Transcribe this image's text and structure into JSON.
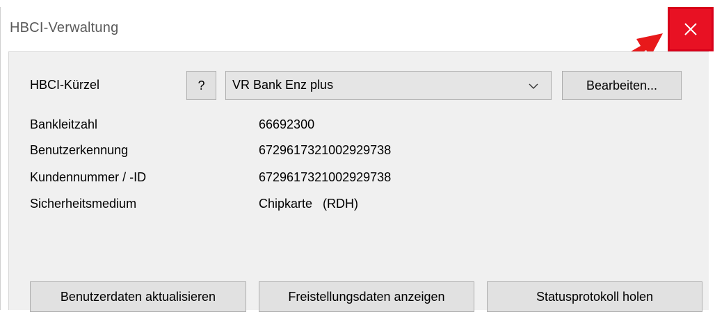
{
  "window": {
    "title": "HBCI-Verwaltung",
    "close_icon": "close-icon",
    "accent_color": "#e81123",
    "annotation_color": "#e8191b"
  },
  "form": {
    "hbci_kuerzel_label": "HBCI-Kürzel",
    "help_button_label": "?",
    "selected_bank": "VR Bank Enz plus",
    "edit_button_label": "Bearbeiten...",
    "details": [
      {
        "label": "Bankleitzahl",
        "value": "66692300"
      },
      {
        "label": "Benutzerkennung",
        "value": "6729617321002929738"
      },
      {
        "label": "Kundennummer / -ID",
        "value": "6729617321002929738"
      },
      {
        "label": "Sicherheitsmedium",
        "value": "Chipkarte   (RDH)"
      }
    ]
  },
  "actions": {
    "update_user_data": "Benutzerdaten aktualisieren",
    "show_exemption_data": "Freistellungsdaten anzeigen",
    "fetch_status_log": "Statusprotokoll holen"
  }
}
